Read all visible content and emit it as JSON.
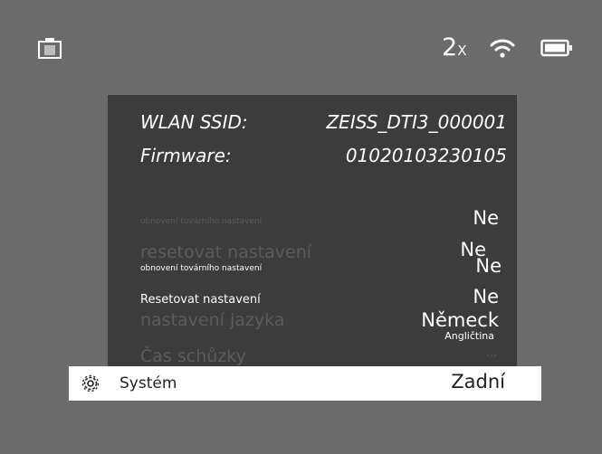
{
  "status": {
    "zoom_value": "2",
    "zoom_unit": "X",
    "icons": [
      "camera-icon",
      "wifi-icon",
      "battery-icon"
    ]
  },
  "info": {
    "wlan_label": "WLAN SSID:",
    "wlan_value": "ZEISS_DTI3_000001",
    "firmware_label": "Firmware:",
    "firmware_value": "01020103230105"
  },
  "menu": {
    "row_factory_small_1": "obnovení továrního nastavení",
    "row_factory_value_1": "Ne",
    "row_reset_faded": "resetovat nastavení",
    "row_reset_faded_value": "Ne",
    "row_factory_small_2": "obnovení továrního nastavení",
    "row_factory_value_2": "Ne",
    "row_reset_label": "Resetovat nastavení",
    "row_reset_value": "Ne",
    "row_language_label": "nastavení jazyka",
    "row_language_value": "Německ",
    "row_language_sub": "Angličtina",
    "row_time_label": "Čas schůzky",
    "row_time_value": "..."
  },
  "selected": {
    "label": "Systém",
    "value": "Zadní",
    "icon": "gear-icon"
  },
  "colors": {
    "background": "#6b6b6b",
    "panel": "#3c3c3c",
    "dim_text": "#5c5c5c"
  }
}
